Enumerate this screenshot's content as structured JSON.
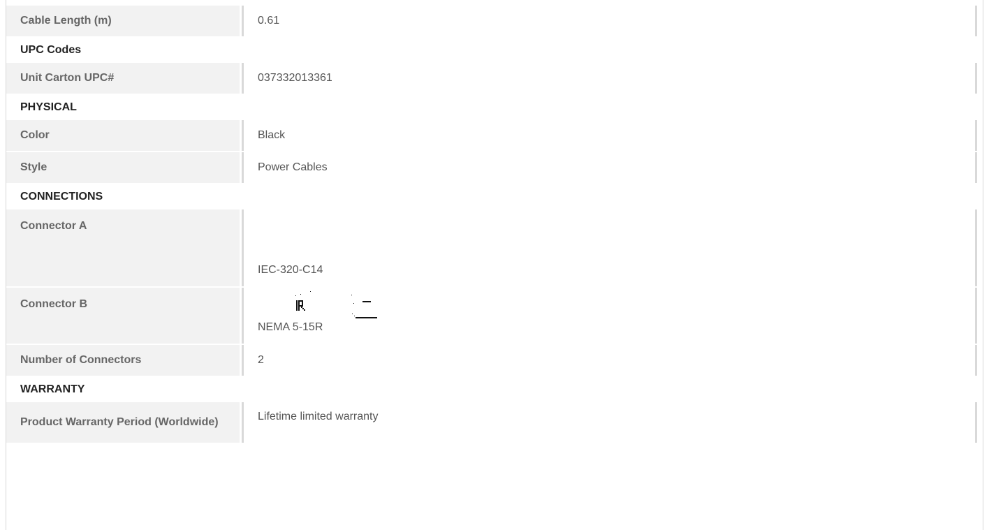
{
  "sections": {
    "cable_length_label": "Cable Length (m)",
    "cable_length_value": "0.61",
    "upc_header": "UPC Codes",
    "unit_carton_label": "Unit Carton UPC#",
    "unit_carton_value": "037332013361",
    "physical_header": "PHYSICAL",
    "color_label": "Color",
    "color_value": "Black",
    "style_label": "Style",
    "style_value": "Power Cables",
    "connections_header": "CONNECTIONS",
    "connector_a_label": "Connector A",
    "connector_a_value": "IEC-320-C14",
    "connector_b_label": "Connector B",
    "connector_b_value": "NEMA 5-15R",
    "num_connectors_label": "Number of Connectors",
    "num_connectors_value": "2",
    "warranty_header": "WARRANTY",
    "warranty_label": "Product Warranty Period (Worldwide)",
    "warranty_value": "Lifetime limited warranty"
  },
  "icons": {
    "connector_b_image": "nema-5-15r-connector-icon"
  },
  "colors": {
    "label_bg": "#f2f2f2",
    "border": "#d9d9d9",
    "text": "#555555"
  }
}
